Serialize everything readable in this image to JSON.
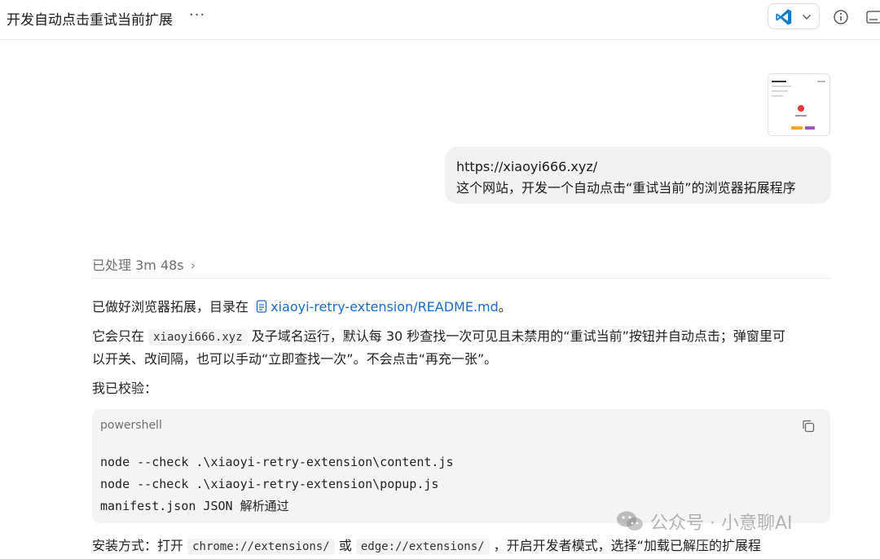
{
  "header": {
    "title": "开发自动点击重试当前扩展",
    "more_label": "···"
  },
  "user_message": {
    "line1": "https://xiaoyi666.xyz/",
    "line2": "这个网站，开发一个自动点击“重试当前”的浏览器拓展程序"
  },
  "status": {
    "processed_label": "已处理 3m 48s",
    "chevron": "›"
  },
  "answer": {
    "p1_prefix": "已做好浏览器拓展，目录在 ",
    "p1_link": "xiaoyi-retry-extension/README.md",
    "p1_suffix": "。",
    "p2_prefix": "它会只在 ",
    "p2_code": "xiaoyi666.xyz",
    "p2_suffix": " 及子域名运行，默认每 30 秒查找一次可见且未禁用的“重试当前”按钮并自动点击；弹窗里可",
    "p2_line2": "以开关、改间隔，也可以手动“立即查找一次”。不会点击“再充一张”。",
    "p3": "我已校验：",
    "p4_prefix": "安装方式：打开 ",
    "p4_code1": "chrome://extensions/",
    "p4_mid": " 或 ",
    "p4_code2": "edge://extensions/",
    "p4_suffix": " ，开启开发者模式，选择“加载已解压的扩展程"
  },
  "code_block": {
    "language": "powershell",
    "lines": [
      "node --check .\\xiaoyi-retry-extension\\content.js",
      "node --check .\\xiaoyi-retry-extension\\popup.js",
      "manifest.json JSON 解析通过"
    ]
  },
  "watermark": {
    "text": "公众号 · 小意聊AI"
  },
  "icons": [
    "vscode-icon",
    "chevron-down-icon",
    "info-icon",
    "panel-icon",
    "file-icon",
    "copy-icon",
    "wechat-icon"
  ],
  "colors": {
    "link": "#1a6cc7",
    "bubble": "#f1f1f1",
    "code_bg": "#f4f4f4",
    "vscode_blue": "#0a7acc"
  }
}
